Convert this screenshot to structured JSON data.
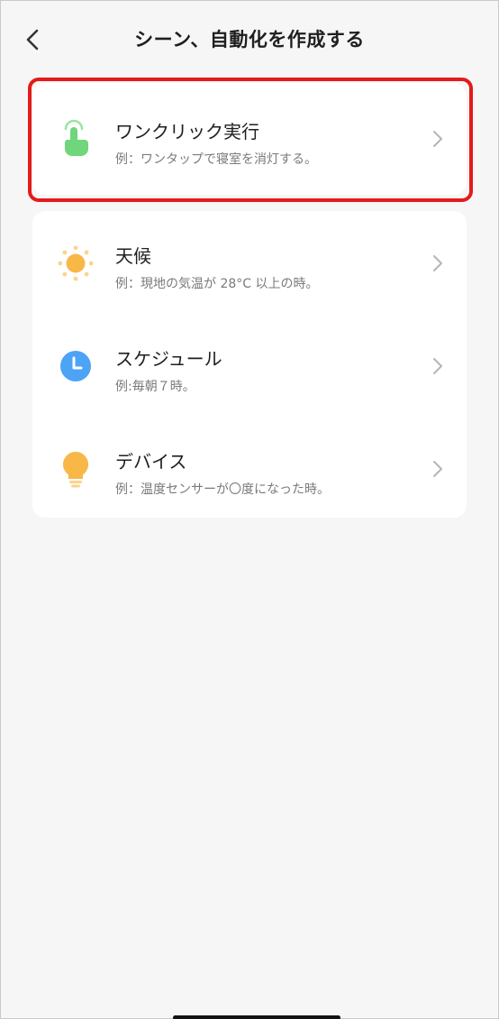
{
  "header": {
    "title": "シーン、自動化を作成する",
    "back_icon": "chevron-left-icon"
  },
  "one_click": {
    "label": "ワンクリック実行",
    "description": "例：ワンタップで寝室を消灯する。",
    "icon": "tap-hand-icon",
    "highlight_color": "#e31b1b"
  },
  "conditions": [
    {
      "label": "天候",
      "description": "例：現地の気温が 28°C 以上の時。",
      "icon": "sun-icon"
    },
    {
      "label": "スケジュール",
      "description": "例:毎朝７時。",
      "icon": "clock-icon"
    },
    {
      "label": "デバイス",
      "description": "例：温度センサーが〇度になった時。",
      "icon": "lightbulb-icon"
    }
  ],
  "colors": {
    "background": "#f6f6f6",
    "card": "#ffffff",
    "green_icon": "#6fd67b",
    "sun": "#f7b848",
    "clock": "#4da3f5",
    "bulb": "#f7b848"
  }
}
